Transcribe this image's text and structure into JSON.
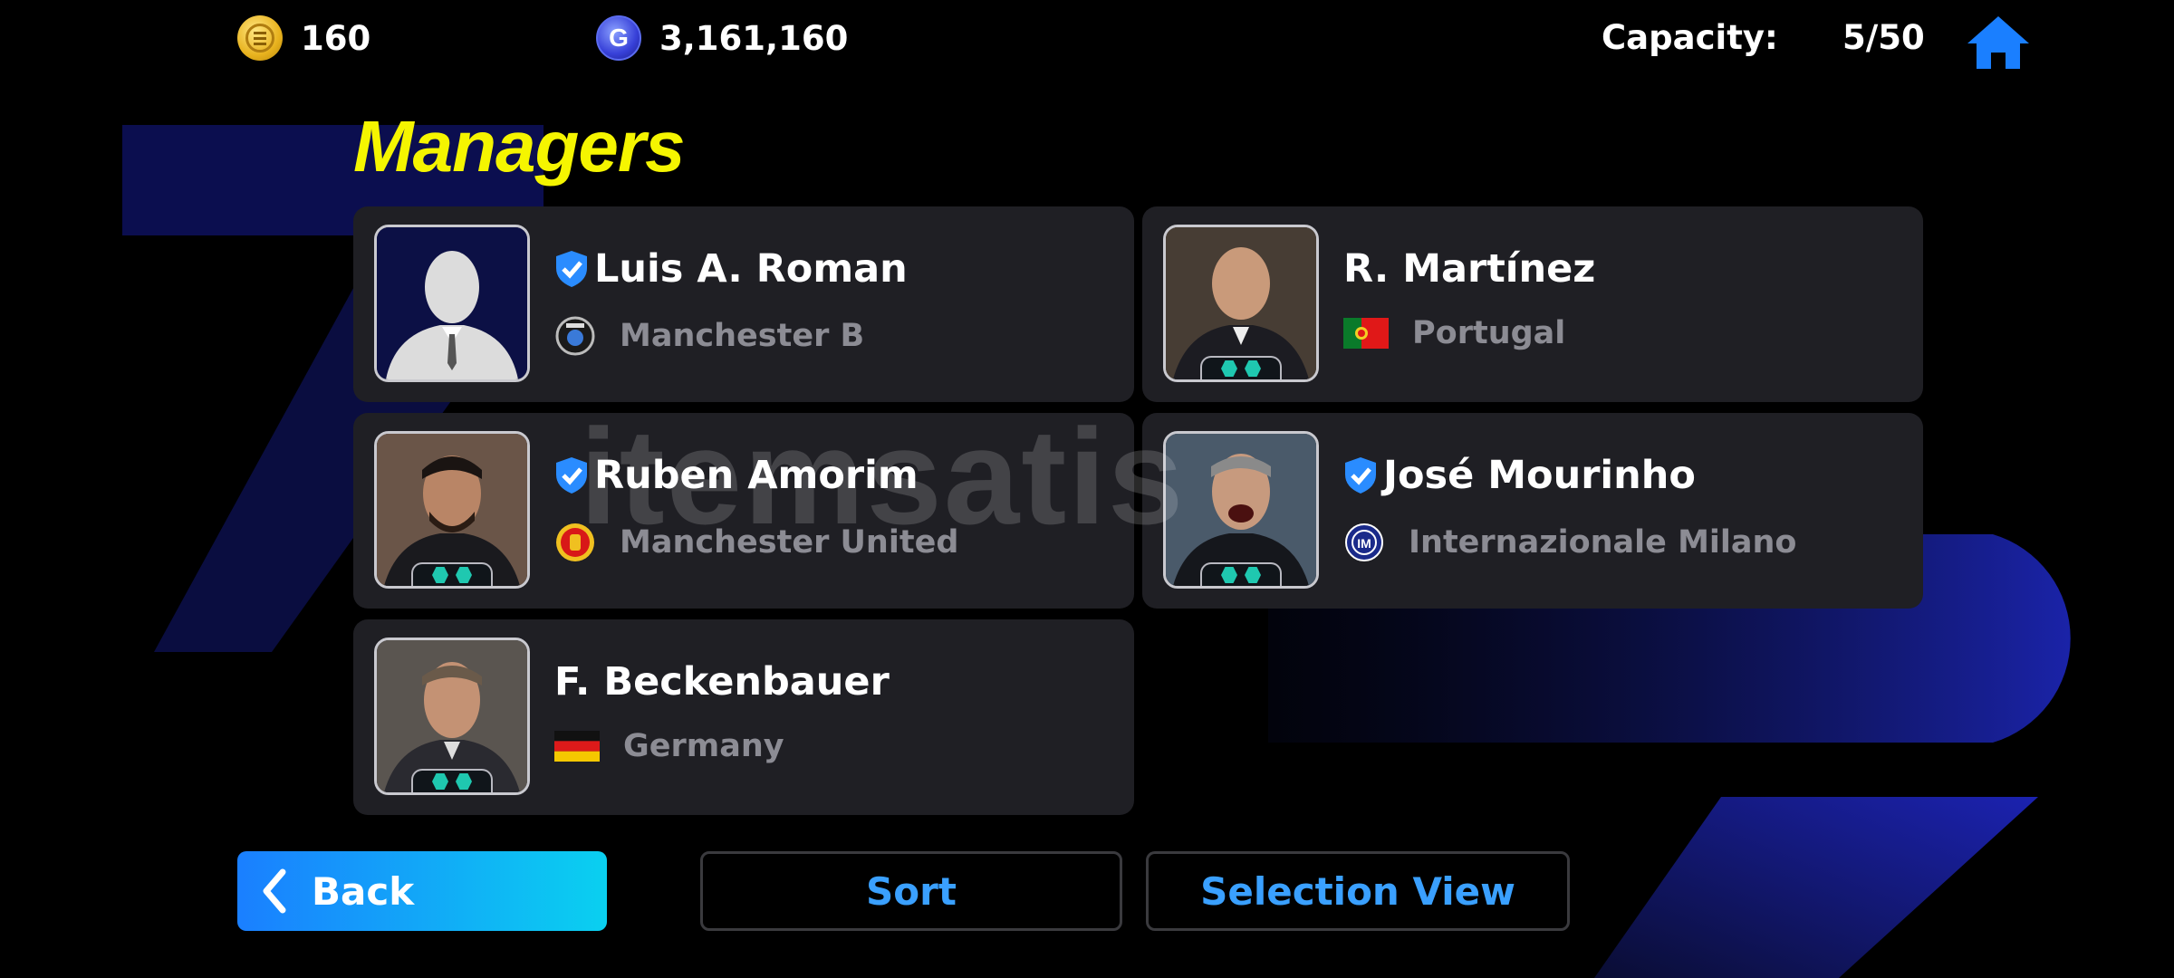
{
  "header": {
    "ecoins": "160",
    "gp": "3,161,160",
    "gp_icon_letter": "G",
    "capacity_label": "Capacity:",
    "capacity_value": "5/50",
    "home_icon": "home-icon"
  },
  "title": "Managers",
  "managers": [
    {
      "name": "Luis A. Roman",
      "team": "Manchester B",
      "verified": true,
      "photo": "placeholder-silhouette",
      "badge": false
    },
    {
      "name": "R. Martínez",
      "team": "Portugal",
      "verified": false,
      "photo": "portrait",
      "badge": true
    },
    {
      "name": "Ruben Amorim",
      "team": "Manchester United",
      "verified": true,
      "photo": "portrait",
      "badge": true
    },
    {
      "name": "José Mourinho",
      "team": "Internazionale Milano",
      "verified": true,
      "photo": "portrait",
      "badge": true
    },
    {
      "name": "F. Beckenbauer",
      "team": "Germany",
      "verified": false,
      "photo": "portrait",
      "badge": true
    }
  ],
  "buttons": {
    "back": "Back",
    "sort": "Sort",
    "selection_view": "Selection View"
  },
  "watermark": "itemsatis",
  "colors": {
    "title": "#f5f500",
    "accent_blue": "#3aa0ff",
    "card_bg": "#1f1f24",
    "verified": "#2a8cff"
  }
}
